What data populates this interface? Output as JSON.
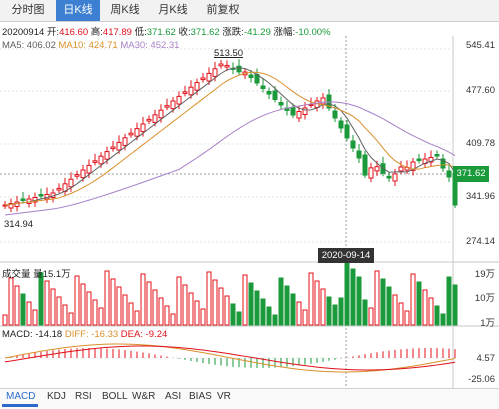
{
  "tabs": [
    {
      "label": "分时图",
      "active": false
    },
    {
      "label": "日K线",
      "active": true
    },
    {
      "label": "周K线",
      "active": false
    },
    {
      "label": "月K线",
      "active": false
    },
    {
      "label": "前复权",
      "active": false
    }
  ],
  "info": {
    "date": "20200914",
    "open_label": "开:",
    "open": "416.60",
    "high_label": "高:",
    "high": "417.89",
    "low_label": "低:",
    "low": "371.62",
    "close_label": "收:",
    "close": "371.62",
    "change_label": "涨跌:",
    "change": "-41.29",
    "pct_label": "涨幅:",
    "pct": "-10.00%"
  },
  "ma": {
    "ma5": "MA5: 406.02",
    "ma10": "MA10: 424.71",
    "ma30": "MA30: 452.31"
  },
  "price_axis": [
    "545.41",
    "477.60",
    "409.78",
    "341.96",
    "274.14"
  ],
  "current_price": "371.62",
  "high_marker": "513.50",
  "low_marker": "314.94",
  "cursor_date": "2020-09-14",
  "volume": {
    "title": "成交量",
    "value_label": "量15.1万",
    "axis": [
      "19万",
      "10万",
      "1万"
    ]
  },
  "macd": {
    "macd": "MACD: -14.18",
    "diff": "DIFF: -16.33",
    "dea": "DEA: -9.24",
    "axis": [
      "4.57",
      "-25.06"
    ]
  },
  "indicators": [
    {
      "label": "MACD",
      "active": true
    },
    {
      "label": "KDJ",
      "active": false
    },
    {
      "label": "RSI",
      "active": false
    },
    {
      "label": "BOLL",
      "active": false
    },
    {
      "label": "W&R",
      "active": false
    },
    {
      "label": "ASI",
      "active": false
    },
    {
      "label": "BIAS",
      "active": false
    },
    {
      "label": "VR",
      "active": false
    }
  ],
  "colors": {
    "up": "#e0101a",
    "down": "#1a9a3a",
    "ma5": "#606060",
    "ma10": "#d98f2a",
    "ma30": "#a780c7",
    "accent": "#3d7fd1"
  }
}
